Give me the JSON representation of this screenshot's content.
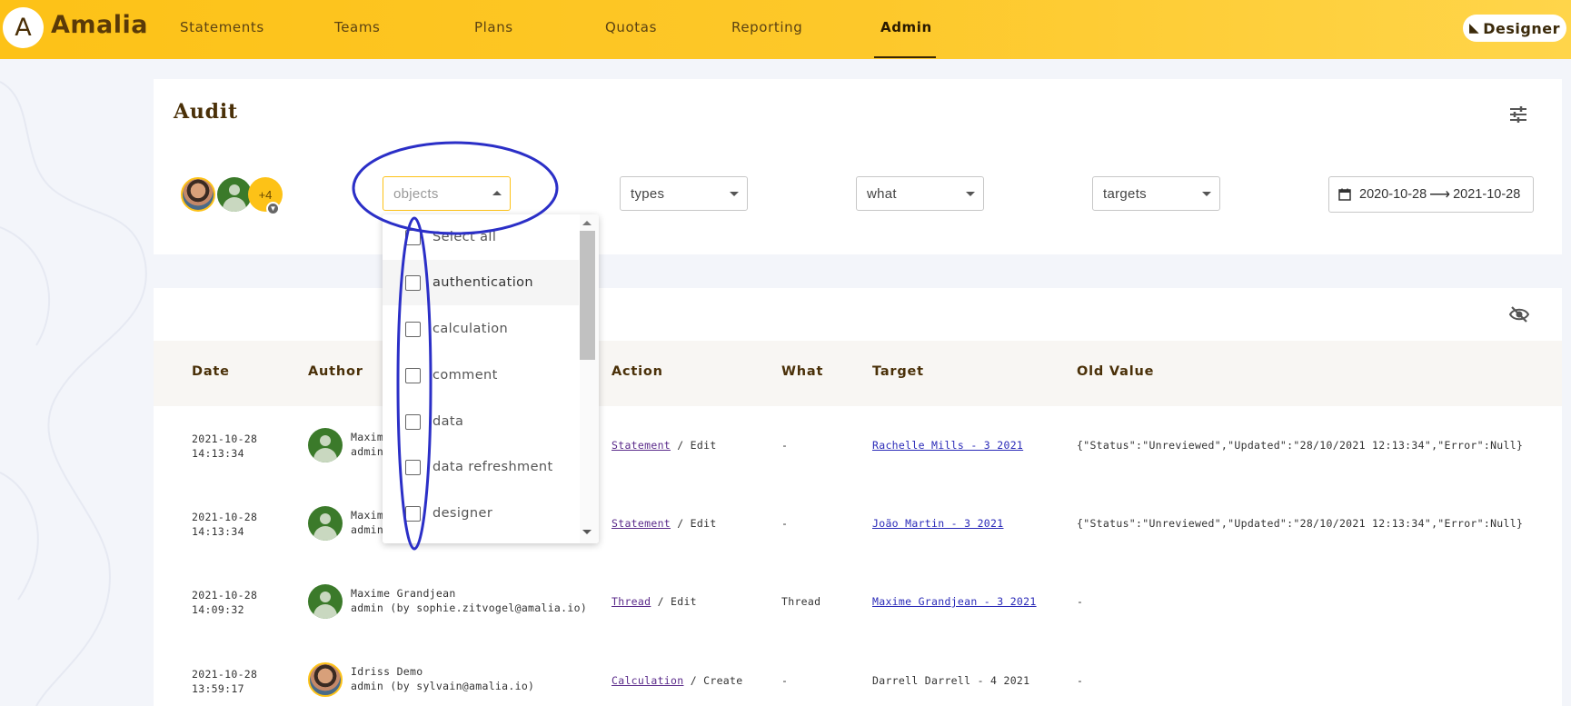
{
  "app": {
    "logo_letter": "A",
    "name": "Amalia"
  },
  "nav": {
    "items": [
      {
        "label": "Statements"
      },
      {
        "label": "Teams"
      },
      {
        "label": "Plans"
      },
      {
        "label": "Quotas"
      },
      {
        "label": "Reporting"
      },
      {
        "label": "Admin",
        "active": true
      }
    ],
    "designer_label": "Designer"
  },
  "audit": {
    "title": "Audit",
    "more_users": "+4",
    "filters": {
      "objects_placeholder": "objects",
      "types_label": "types",
      "what_label": "what",
      "targets_label": "targets",
      "date_from": "2020-10-28",
      "date_arrow": "⟶",
      "date_to": "2021-10-28"
    }
  },
  "dropdown": {
    "options": [
      {
        "label": "Select all",
        "checked": false
      },
      {
        "label": "authentication",
        "checked": false
      },
      {
        "label": "calculation",
        "checked": false
      },
      {
        "label": "comment",
        "checked": false
      },
      {
        "label": "data",
        "checked": false
      },
      {
        "label": "data refreshment",
        "checked": false
      },
      {
        "label": "designer",
        "checked": false
      }
    ]
  },
  "table": {
    "headers": [
      "Date",
      "Author",
      "Action",
      "What",
      "Target",
      "Old Value"
    ],
    "rows": [
      {
        "date": "2021-10-28",
        "time": "14:13:34",
        "author_name": "Maxim",
        "author_role": "admin",
        "action_link": "Statement",
        "action_rest": " / Edit",
        "what": "-",
        "target": "Rachelle Mills - 3 2021",
        "old_value": "{\"Status\":\"Unreviewed\",\"Updated\":\"28/10/2021 12:13:34\",\"Error\":Null}"
      },
      {
        "date": "2021-10-28",
        "time": "14:13:34",
        "author_name": "Maxim",
        "author_role": "admin",
        "action_link": "Statement",
        "action_rest": " / Edit",
        "what": "-",
        "target": "João Martin - 3 2021",
        "old_value": "{\"Status\":\"Unreviewed\",\"Updated\":\"28/10/2021 12:13:34\",\"Error\":Null}"
      },
      {
        "date": "2021-10-28",
        "time": "14:09:32",
        "author_name": "Maxime Grandjean",
        "author_role": "admin (by sophie.zitvogel@amalia.io)",
        "action_link": "Thread",
        "action_rest": " / Edit",
        "what": "Thread",
        "target": "Maxime Grandjean - 3 2021",
        "old_value": "-"
      },
      {
        "date": "2021-10-28",
        "time": "13:59:17",
        "author_name": "Idriss Demo",
        "author_role": "admin (by sylvain@amalia.io)",
        "action_link": "Calculation",
        "action_rest": " / Create",
        "what": "-",
        "target": "Darrell Darrell - 4 2021",
        "old_value": "-"
      }
    ]
  },
  "colors": {
    "brand_yellow": "#fdc217",
    "brand_brown": "#4a3008",
    "annotation_blue": "#2b2fc7"
  }
}
